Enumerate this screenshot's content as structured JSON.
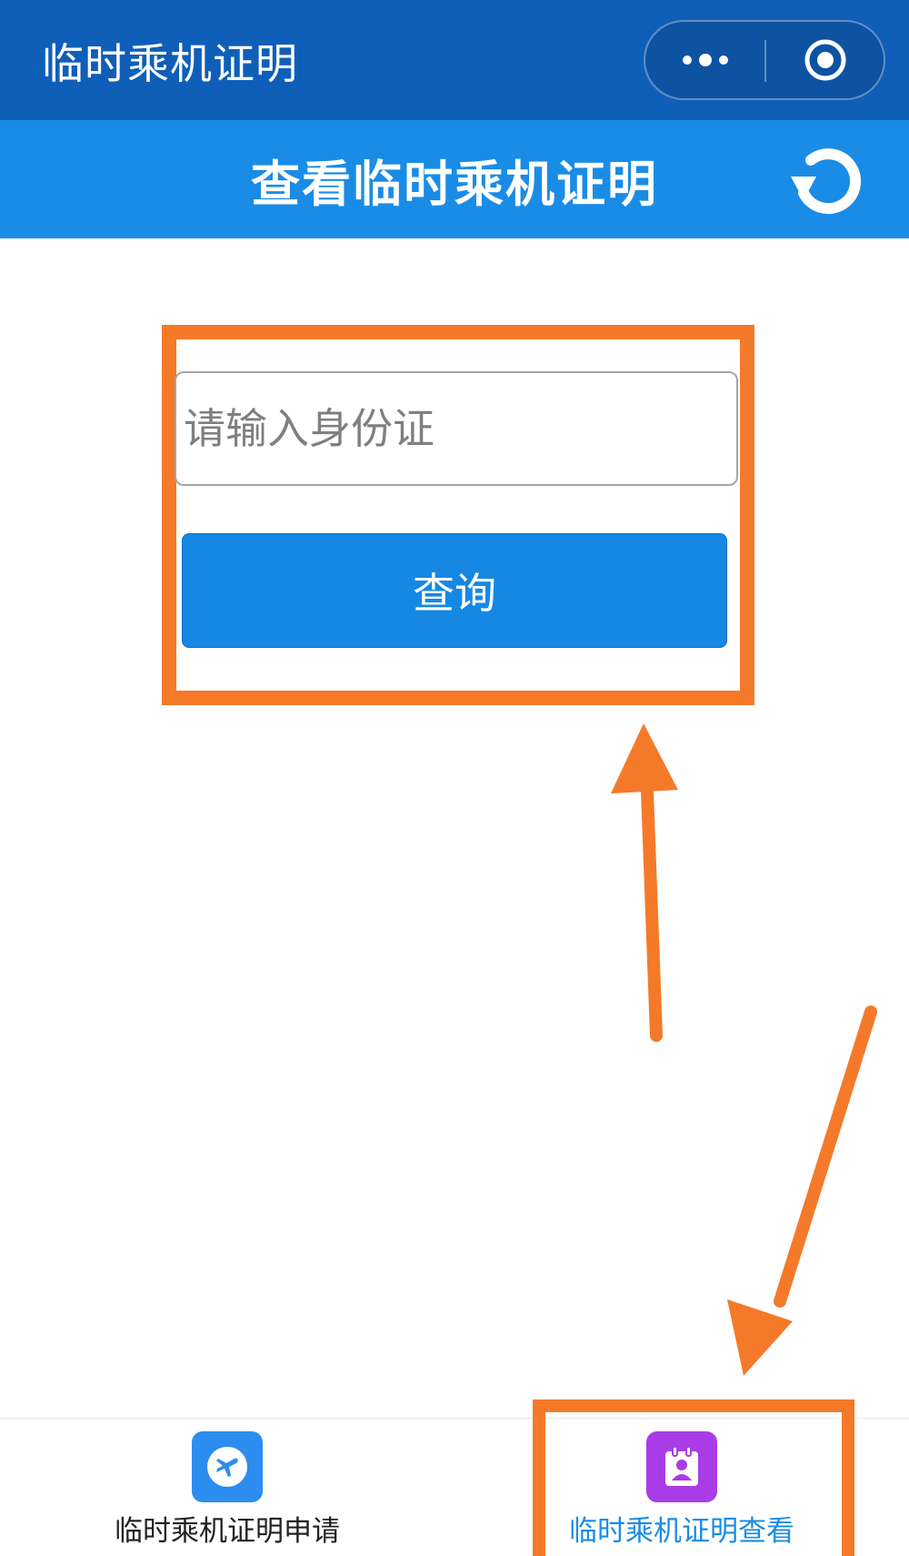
{
  "window": {
    "title": "临时乘机证明",
    "more_icon": "more-dots-icon",
    "close_icon": "target-close-icon"
  },
  "header": {
    "title": "查看临时乘机证明",
    "refresh_icon": "refresh-icon"
  },
  "form": {
    "id_input_placeholder": "请输入身份证",
    "id_input_value": "",
    "query_button_label": "查询"
  },
  "tabs": [
    {
      "label": "临时乘机证明申请",
      "icon": "airplane-icon",
      "active": false
    },
    {
      "label": "临时乘机证明查看",
      "icon": "id-badge-icon",
      "active": true
    }
  ],
  "colors": {
    "title_bar": "#0f5fb9",
    "header": "#1a8ce6",
    "button": "#1688e4",
    "annotation": "#f47a2a",
    "active_tab_text": "#1a8ce6"
  }
}
